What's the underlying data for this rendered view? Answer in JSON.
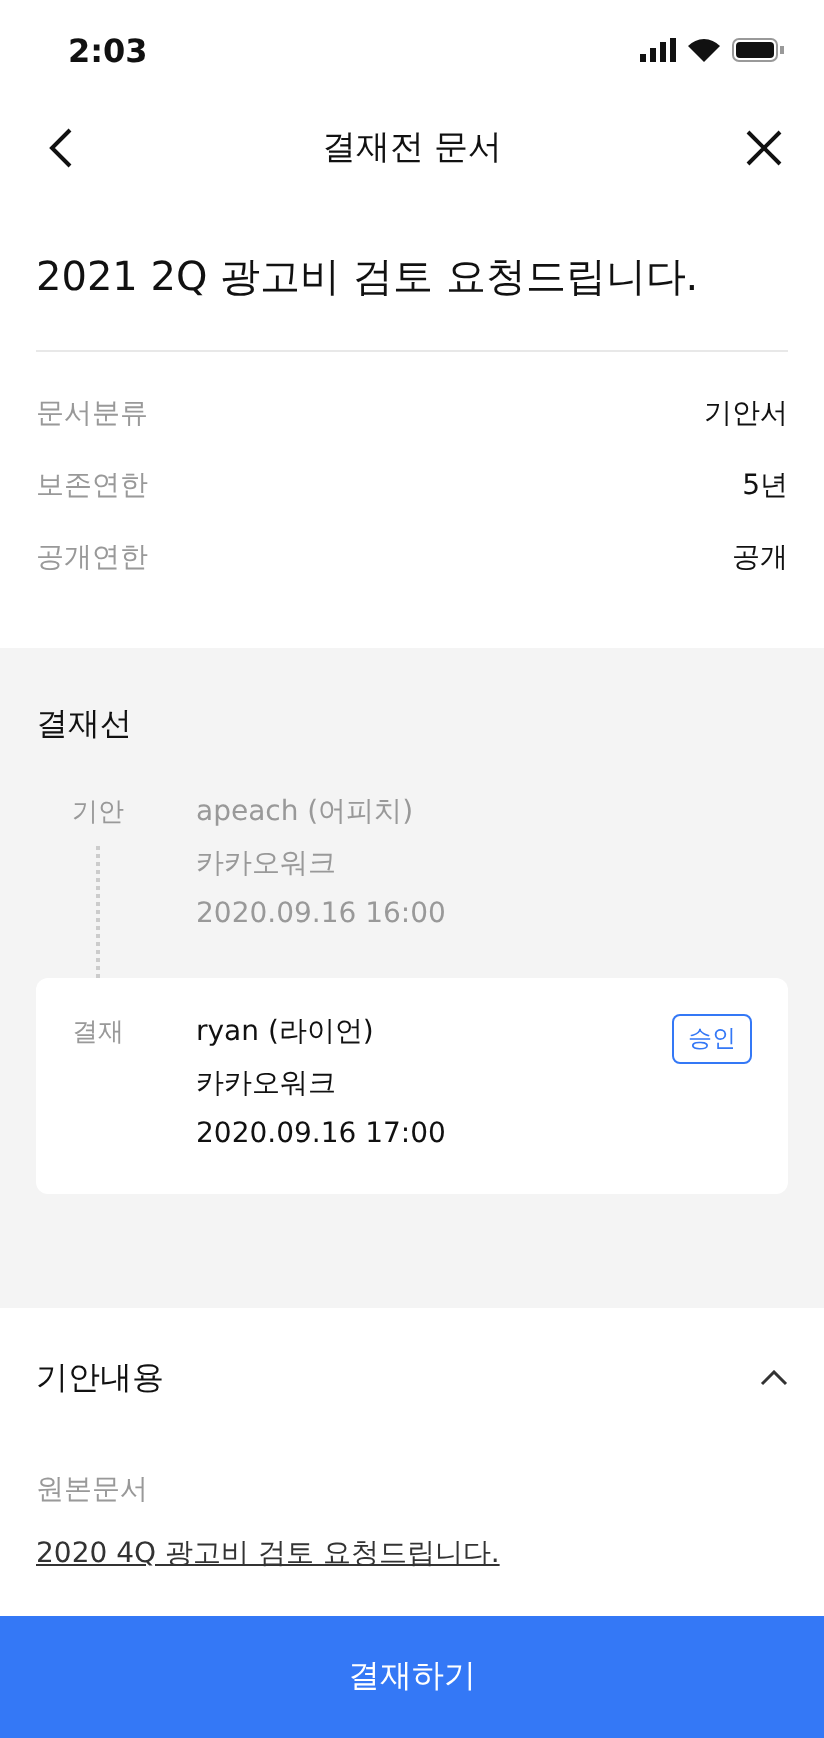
{
  "status_bar": {
    "time": "2:03"
  },
  "nav": {
    "title": "결재전 문서"
  },
  "document": {
    "title": "2021 2Q 광고비 검토 요청드립니다."
  },
  "info_rows": [
    {
      "label": "문서분류",
      "value": "기안서"
    },
    {
      "label": "보존연한",
      "value": "5년"
    },
    {
      "label": "공개연한",
      "value": "공개"
    }
  ],
  "approval_line": {
    "title": "결재선",
    "steps": [
      {
        "role": "기안",
        "name": "apeach (어피치)",
        "company": "카카오워크",
        "time": "2020.09.16 16:00",
        "current": false
      },
      {
        "role": "결재",
        "name": "ryan (라이언)",
        "company": "카카오워크",
        "time": "2020.09.16 17:00",
        "current": true,
        "badge": "승인"
      }
    ]
  },
  "content_section": {
    "title": "기안내용",
    "expanded": true,
    "original_label": "원본문서",
    "original_link": "2020 4Q 광고비 검토 요청드립니다."
  },
  "primary_button": {
    "label": "결재하기"
  }
}
